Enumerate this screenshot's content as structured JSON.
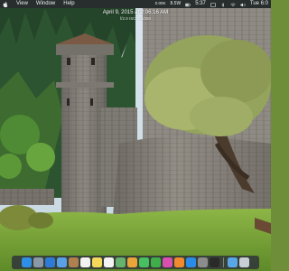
{
  "menubar": {
    "apple_icon": "apple-icon",
    "menus": [
      "View",
      "Window",
      "Help"
    ],
    "network_rate": "0.00K",
    "network_rate_2": "8.5W",
    "battery_time": "5:37",
    "clock": "Tue 6:0"
  },
  "overlay": {
    "date": "April 9, 2015 at 2:06:16 AM",
    "subtitle": "f/2.8  ISO 8  1/250"
  },
  "dock": {
    "apps": [
      {
        "name": "finder-icon",
        "color": "#2f8fe6"
      },
      {
        "name": "launchpad-icon",
        "color": "#8a98a8"
      },
      {
        "name": "safari-icon",
        "color": "#2e7bd7"
      },
      {
        "name": "mail-icon",
        "color": "#5aa0e6"
      },
      {
        "name": "contacts-icon",
        "color": "#b08050"
      },
      {
        "name": "calendar-icon",
        "color": "#f2f2f2"
      },
      {
        "name": "notes-icon",
        "color": "#f7d95a"
      },
      {
        "name": "reminders-icon",
        "color": "#f4f4f4"
      },
      {
        "name": "maps-icon",
        "color": "#67b26f"
      },
      {
        "name": "photos-icon",
        "color": "#e9a53b"
      },
      {
        "name": "messages-icon",
        "color": "#46c060"
      },
      {
        "name": "facetime-icon",
        "color": "#3fae4a"
      },
      {
        "name": "itunes-icon",
        "color": "#d94fb0"
      },
      {
        "name": "ibooks-icon",
        "color": "#ef8a2f"
      },
      {
        "name": "app-store-icon",
        "color": "#2b8ce8"
      },
      {
        "name": "system-preferences-icon",
        "color": "#8c8c8c"
      },
      {
        "name": "terminal-icon",
        "color": "#2a2a2a"
      },
      {
        "name": "folder-icon",
        "color": "#5aa7e8"
      },
      {
        "name": "trash-icon",
        "color": "#c9ced4"
      }
    ]
  }
}
